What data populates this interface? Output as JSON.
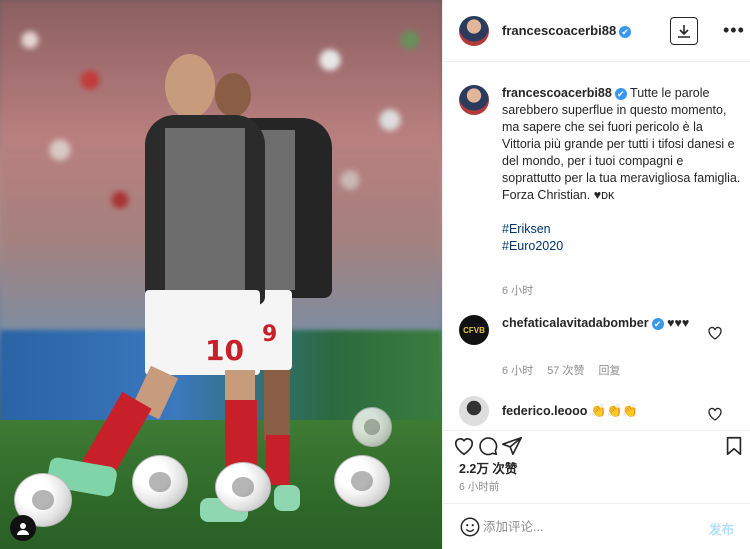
{
  "post": {
    "username": "francescoacerbi88",
    "verified_mark": "✔",
    "caption_lines": [
      "Tutte le parole sarebbero superflue in questo momento, ma sapere che sei fuori pericolo è la Vittoria più grande per tutti i tifosi danesi e del mondo, per i tuoi compagni e soprattutto per la tua meravigliosa famiglia.",
      "Forza Christian. ♥ᴅᴋ"
    ],
    "hashtags": [
      "#Eriksen",
      "#Euro2020"
    ],
    "caption_time": "6 小时"
  },
  "comments": [
    {
      "avatar_text": "CFVB",
      "username": "chefaticalavitadabomber",
      "text": "♥♥♥",
      "time": "6 小时",
      "likes": "57 次赞",
      "reply": "回复"
    },
    {
      "username": "federico.leooo",
      "text": "👏👏👏"
    }
  ],
  "actions": {
    "likes_count": "2.2万 次赞",
    "post_time": "6 小时前"
  },
  "add_comment": {
    "placeholder": "添加评论...",
    "post_label": "发布"
  },
  "photo": {
    "front_number": "10",
    "back_number": "9"
  },
  "icons": [
    "download-icon",
    "more-icon",
    "heart-icon",
    "comment-icon",
    "share-icon",
    "bookmark-icon",
    "smile-icon",
    "user-icon"
  ]
}
